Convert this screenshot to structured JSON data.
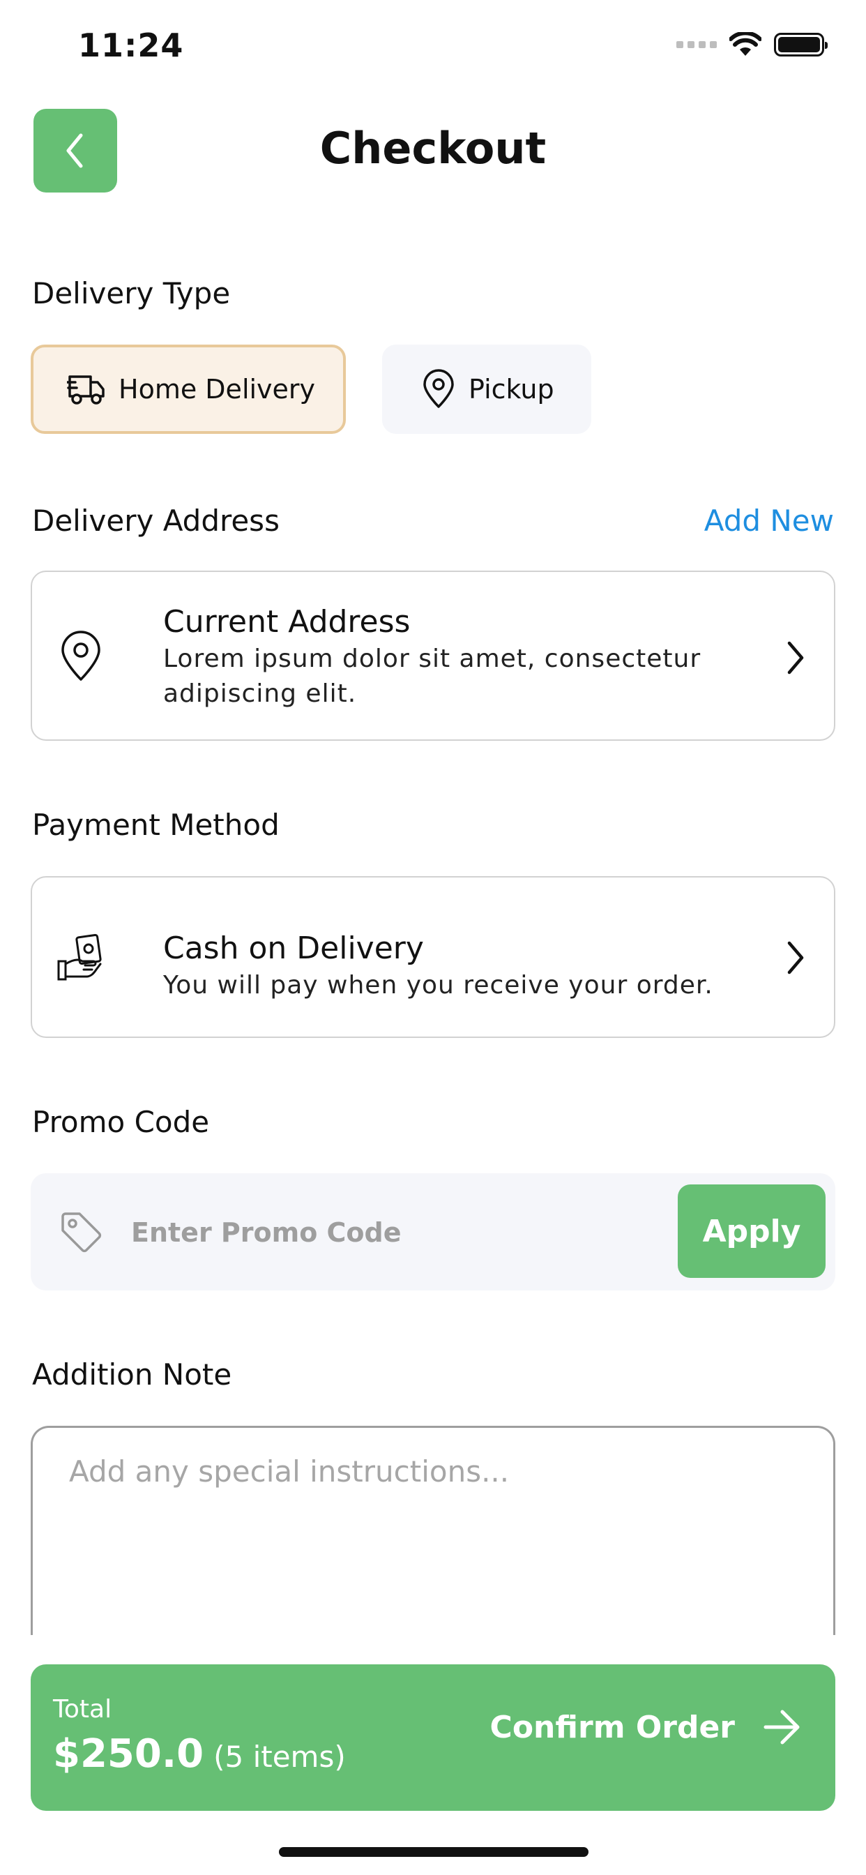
{
  "status_bar": {
    "time": "11:24"
  },
  "header": {
    "title": "Checkout"
  },
  "delivery_type": {
    "title": "Delivery Type",
    "options": [
      {
        "label": "Home Delivery",
        "icon": "delivery-truck-icon",
        "selected": true
      },
      {
        "label": "Pickup",
        "icon": "location-pin-icon",
        "selected": false
      }
    ]
  },
  "delivery_address": {
    "title": "Delivery Address",
    "add_new": "Add New",
    "card": {
      "icon": "location-pin-icon",
      "title": "Current Address",
      "description": "Lorem ipsum dolor sit amet, consectetur adipiscing elit."
    }
  },
  "payment_method": {
    "title": "Payment Method",
    "card": {
      "icon": "cash-hand-icon",
      "title": "Cash on Delivery",
      "description": "You will pay when you receive your order."
    }
  },
  "promo": {
    "title": "Promo Code",
    "placeholder": "Enter Promo Code",
    "value": "",
    "apply_label": "Apply"
  },
  "note": {
    "title": "Addition Note",
    "placeholder": "Add any special instructions...",
    "value": ""
  },
  "footer": {
    "total_label": "Total",
    "total_amount": "$250.0",
    "items_count": "(5 items)",
    "confirm_label": "Confirm Order"
  },
  "colors": {
    "primary": "#66bf74",
    "link": "#1e8ee0",
    "selected_chip_bg": "#faf1e6",
    "selected_chip_border": "#e8c99a",
    "muted_bg": "#f5f6fa"
  }
}
